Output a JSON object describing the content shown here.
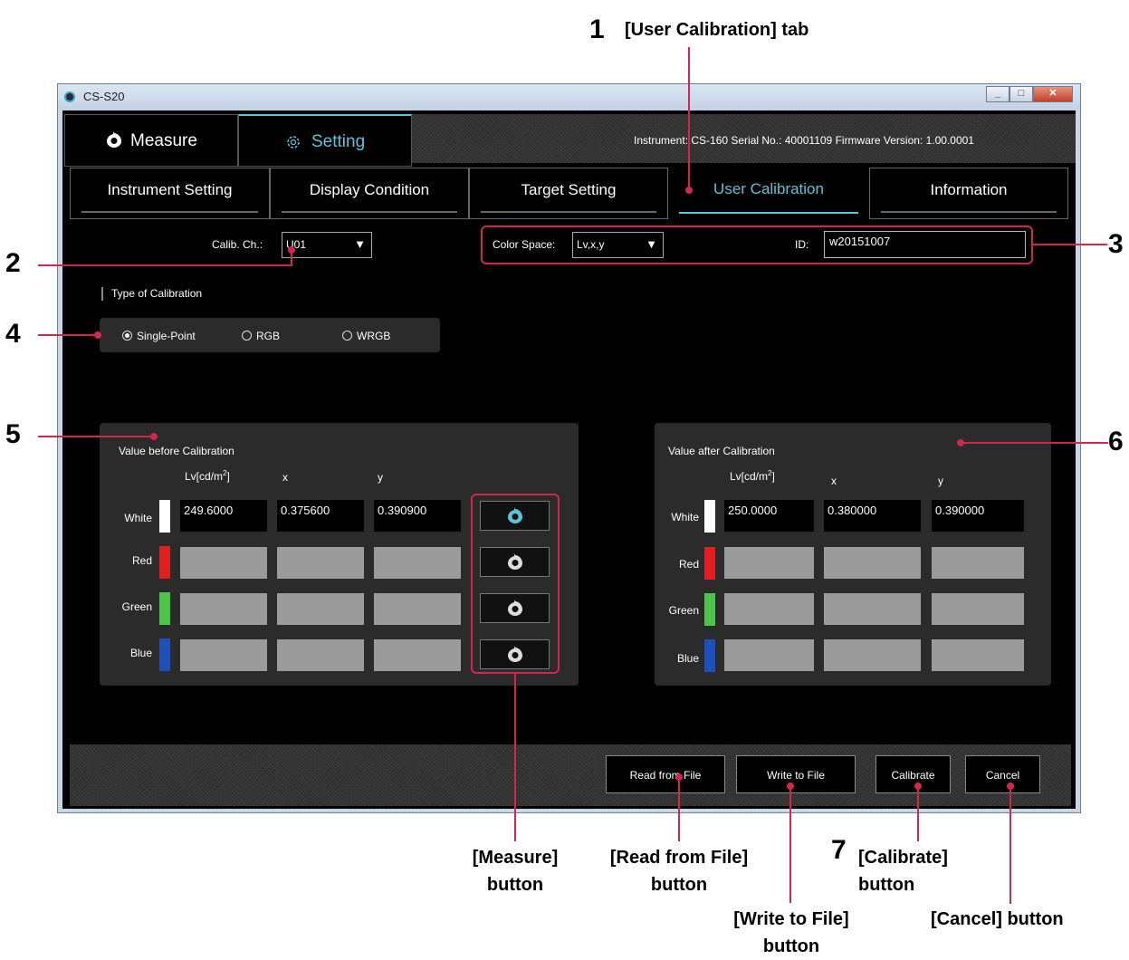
{
  "window": {
    "title": "CS-S20",
    "controls": [
      "minimize",
      "maximize",
      "close"
    ]
  },
  "main_tabs": [
    {
      "label": "Measure",
      "icon": "measure-drop-icon"
    },
    {
      "label": "Setting",
      "icon": "gear-icon",
      "active": true
    }
  ],
  "instrument_info": "Instrument: CS-160  Serial No.: 40001109  Firmware Version: 1.00.0001",
  "sub_tabs": [
    {
      "label": "Instrument Setting"
    },
    {
      "label": "Display Condition"
    },
    {
      "label": "Target Setting"
    },
    {
      "label": "User Calibration",
      "active": true
    },
    {
      "label": "Information"
    }
  ],
  "calib_ch": {
    "label": "Calib. Ch.:",
    "value": "U01"
  },
  "color_space": {
    "label": "Color Space:",
    "value": "Lv,x,y"
  },
  "id_field": {
    "label": "ID:",
    "value": "w20151007"
  },
  "calibration_type": {
    "heading": "Type of Calibration",
    "options": [
      "Single-Point",
      "RGB",
      "WRGB"
    ],
    "selected": "Single-Point"
  },
  "before": {
    "title": "Value before Calibration",
    "col_lv": "Lv[cd/m",
    "col_lv_sup": "2",
    "col_lv_end": "]",
    "col_x": "x",
    "col_y": "y",
    "rows": [
      {
        "label": "White",
        "color": "#ffffff",
        "lv": "249.6000",
        "x": "0.375600",
        "y": "0.390900"
      },
      {
        "label": "Red",
        "color": "#e02020",
        "lv": "",
        "x": "",
        "y": ""
      },
      {
        "label": "Green",
        "color": "#4cc44c",
        "lv": "",
        "x": "",
        "y": ""
      },
      {
        "label": "Blue",
        "color": "#1f4fb8",
        "lv": "",
        "x": "",
        "y": ""
      }
    ]
  },
  "after": {
    "title": "Value after Calibration",
    "col_lv": "Lv[cd/m",
    "col_lv_sup": "2",
    "col_lv_end": "]",
    "col_x": "x",
    "col_y": "y",
    "rows": [
      {
        "label": "White",
        "color": "#ffffff",
        "lv": "250.0000",
        "x": "0.380000",
        "y": "0.390000"
      },
      {
        "label": "Red",
        "color": "#e02020",
        "lv": "",
        "x": "",
        "y": ""
      },
      {
        "label": "Green",
        "color": "#4cc44c",
        "lv": "",
        "x": "",
        "y": ""
      },
      {
        "label": "Blue",
        "color": "#1f4fb8",
        "lv": "",
        "x": "",
        "y": ""
      }
    ]
  },
  "footer_buttons": {
    "read": "Read from File",
    "write": "Write to File",
    "calibrate": "Calibrate",
    "cancel": "Cancel"
  },
  "annotations": {
    "n1": "1",
    "n1_text": "[User Calibration] tab",
    "n2": "2",
    "n3": "3",
    "n4": "4",
    "n5": "5",
    "n6": "6",
    "n7": "7",
    "measure_l1": "[Measure]",
    "measure_l2": "button",
    "read_l1": "[Read from File]",
    "read_l2": "button",
    "write_l1": "[Write to File]",
    "write_l2": "button",
    "calib_l1": "[Calibrate]",
    "calib_l2": "button",
    "cancel_text": "[Cancel] button"
  },
  "colors": {
    "accent": "#5fc3d8",
    "callout": "#d2274d",
    "panel": "#2b2b2b",
    "empty_cell": "#9b9b9b"
  }
}
